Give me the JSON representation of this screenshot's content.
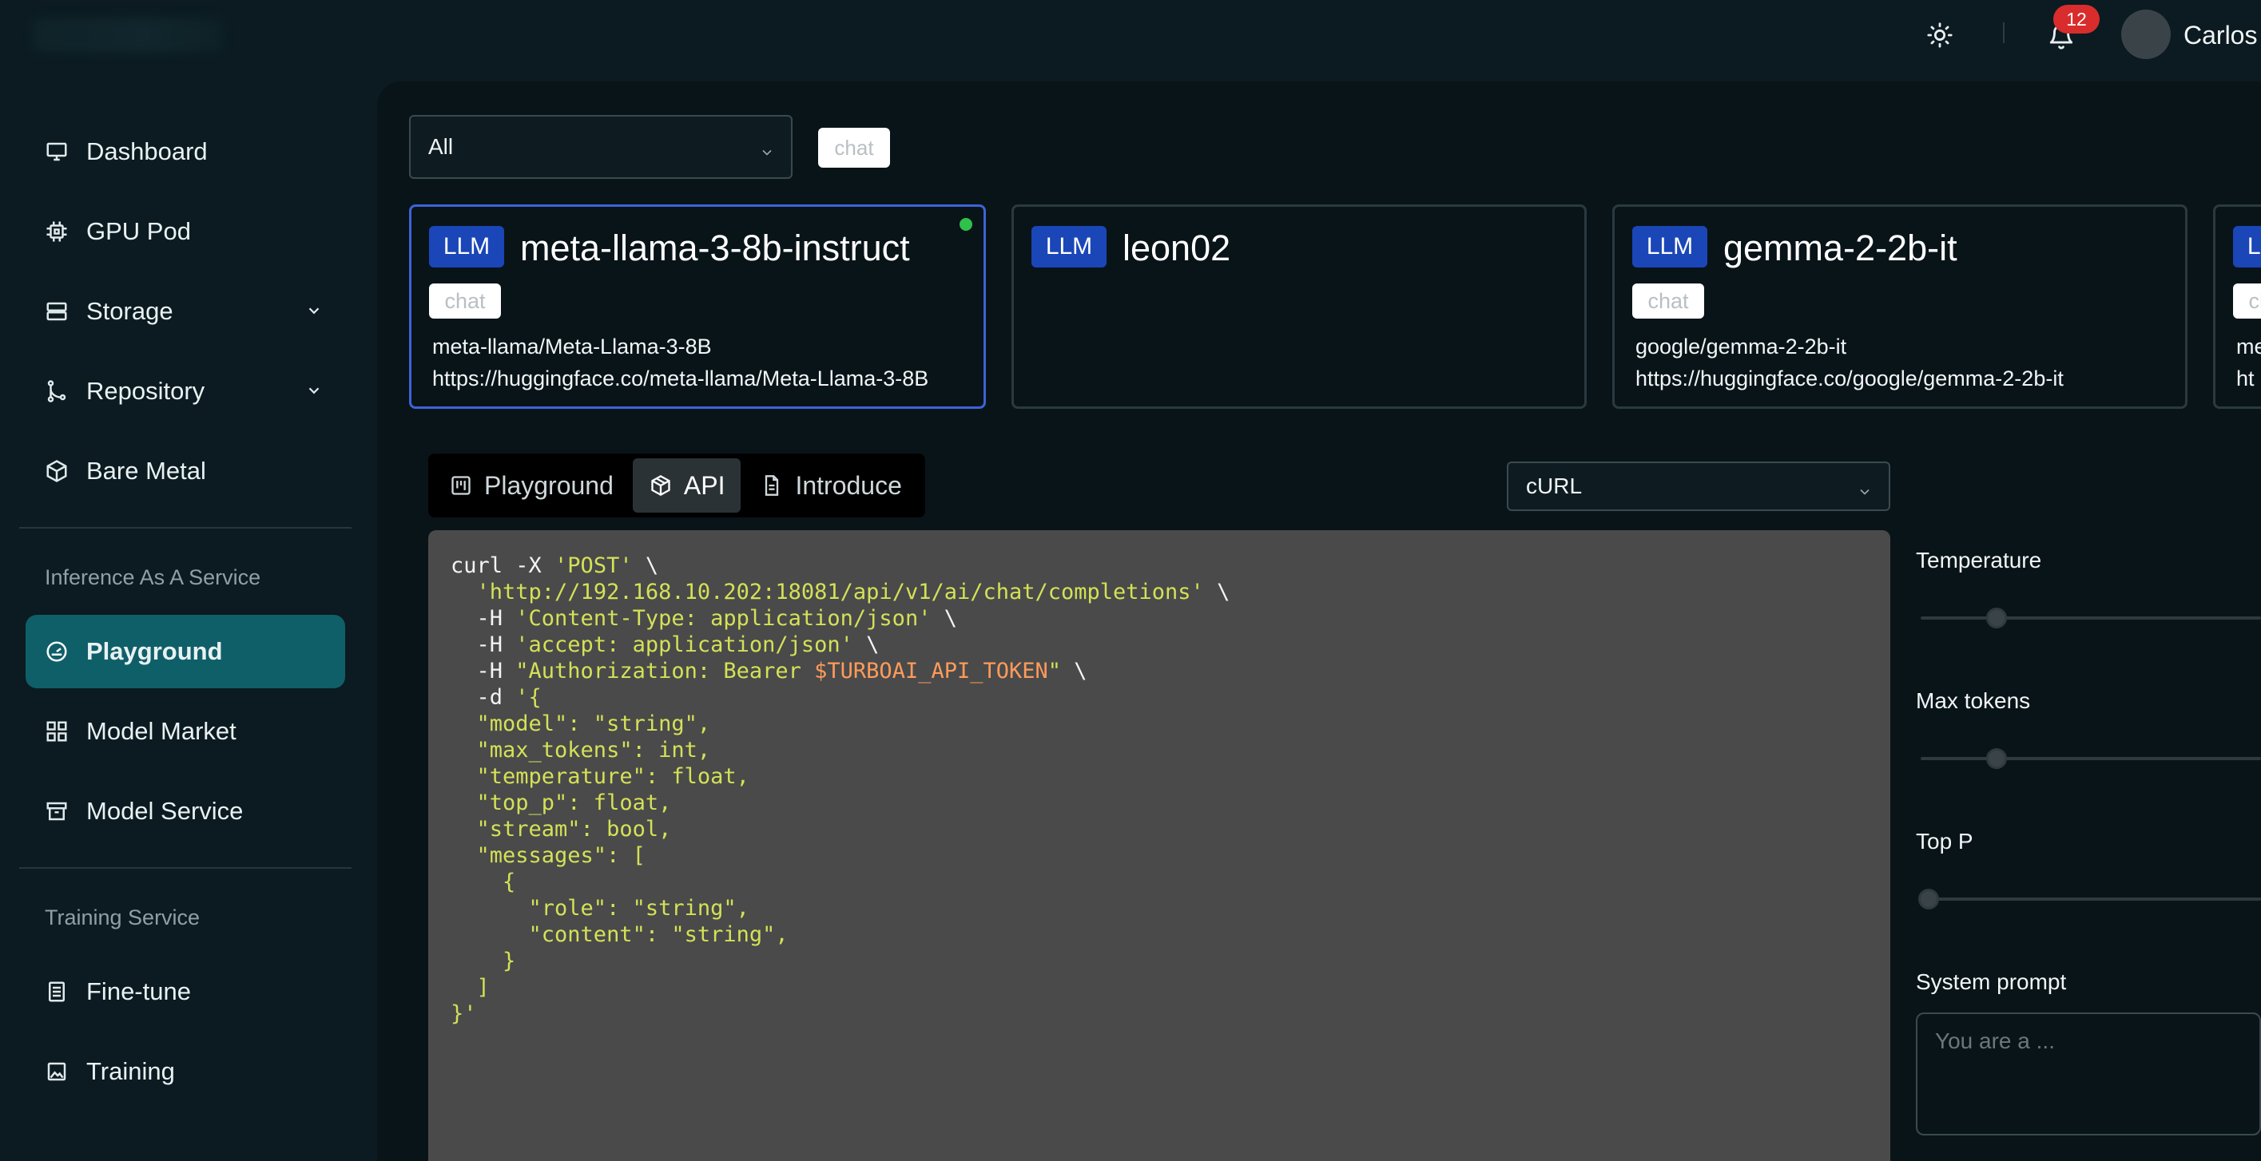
{
  "header": {
    "notification_count": "12",
    "username": "Carlos"
  },
  "sidebar": {
    "items": [
      {
        "label": "Dashboard",
        "icon": "monitor-icon"
      },
      {
        "label": "GPU Pod",
        "icon": "chip-icon"
      },
      {
        "label": "Storage",
        "icon": "server-icon"
      },
      {
        "label": "Repository",
        "icon": "git-branch-icon"
      },
      {
        "label": "Bare Metal",
        "icon": "cube-icon"
      },
      {
        "label": "Playground",
        "icon": "gauge-icon"
      },
      {
        "label": "Model Market",
        "icon": "grid-icon"
      },
      {
        "label": "Model Service",
        "icon": "archive-icon"
      },
      {
        "label": "Fine-tune",
        "icon": "document-list-icon"
      },
      {
        "label": "Training",
        "icon": "image-icon"
      }
    ],
    "sections": [
      "Inference As A Service",
      "Training Service"
    ],
    "active": "Playground"
  },
  "filters": {
    "category_select": "All",
    "tag": "chat"
  },
  "models": [
    {
      "badge": "LLM",
      "name": "meta-llama-3-8b-instruct",
      "tag": "chat",
      "repo": "meta-llama/Meta-Llama-3-8B",
      "url": "https://huggingface.co/meta-llama/Meta-Llama-3-8B",
      "selected": true,
      "online": true
    },
    {
      "badge": "LLM",
      "name": "leon02",
      "tag": "",
      "repo": "",
      "url": ""
    },
    {
      "badge": "LLM",
      "name": "gemma-2-2b-it",
      "tag": "chat",
      "repo": "google/gemma-2-2b-it",
      "url": "https://huggingface.co/google/gemma-2-2b-it"
    },
    {
      "badge": "LLM",
      "name": "",
      "tag": "chat",
      "repo": "me",
      "url": "ht"
    }
  ],
  "tabs": [
    {
      "label": "Playground",
      "icon": "board-icon"
    },
    {
      "label": "API",
      "icon": "package-icon",
      "active": true
    },
    {
      "label": "Introduce",
      "icon": "document-icon"
    }
  ],
  "language_select": "cURL",
  "code": {
    "l1": [
      "curl -X ",
      "'POST'",
      " \\"
    ],
    "l2": [
      "  ",
      "'http://192.168.10.202:18081/api/v1/ai/chat/completions'",
      " \\"
    ],
    "l3": [
      "  -H ",
      "'Content-Type: application/json'",
      " \\"
    ],
    "l4": [
      "  -H ",
      "'accept: application/json'",
      " \\"
    ],
    "l5": [
      "  -H ",
      "\"Authorization: Bearer ",
      "$TURBOAI_API_TOKEN",
      "\"",
      " \\"
    ],
    "l6": [
      "  -d ",
      "'{"
    ],
    "l7": "  \"model\": \"string\",",
    "l8": "  \"max_tokens\": int,",
    "l9": "  \"temperature\": float,",
    "l10": "  \"top_p\": float,",
    "l11": "  \"stream\": bool,",
    "l12": "  \"messages\": [",
    "l13": "    {",
    "l14": "      \"role\": \"string\",",
    "l15": "      \"content\": \"string\",",
    "l16": "    }",
    "l17": "  ]",
    "l18": "}'"
  },
  "params": {
    "temperature_label": "Temperature",
    "max_tokens_label": "Max tokens",
    "top_p_label": "Top P",
    "system_prompt_label": "System prompt",
    "system_prompt_placeholder": "You are a ...",
    "temperature_level": 0.2,
    "max_tokens_level": 0.2,
    "top_p_level": 0.0
  }
}
